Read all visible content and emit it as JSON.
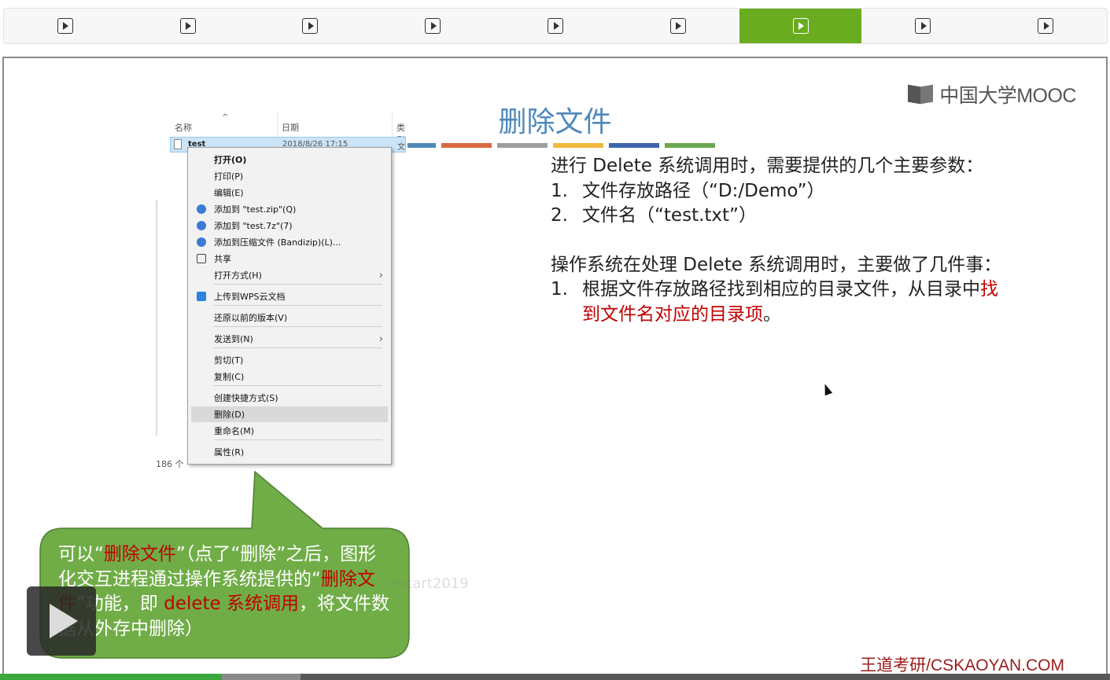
{
  "tabs": [
    {
      "icon": "play-icon",
      "active": false
    },
    {
      "icon": "play-icon",
      "active": false
    },
    {
      "icon": "play-icon",
      "active": false
    },
    {
      "icon": "play-icon",
      "active": false
    },
    {
      "icon": "play-icon",
      "active": false
    },
    {
      "icon": "play-icon",
      "active": false
    },
    {
      "icon": "play-icon",
      "active": true
    },
    {
      "icon": "play-icon",
      "active": false
    },
    {
      "icon": "play-icon",
      "active": false
    }
  ],
  "colors": {
    "active_tab": "#6aac1f",
    "title": "#4f88bb",
    "highlight": "#c00000",
    "callout": "#70ad47",
    "progress": "#3aa83a"
  },
  "logo": {
    "text": "中国大学MOOC"
  },
  "slide": {
    "title": "删除文件",
    "stripe_colors": [
      "#4f88bb",
      "#d9693f",
      "#9e9e9e",
      "#f0b840",
      "#3d64ae",
      "#6aa84f"
    ]
  },
  "explorer": {
    "col_name": "名称",
    "col_date": "日期",
    "col_type": "类型",
    "file_name": "test",
    "file_date": "2018/8/26 17:15",
    "file_type": "文",
    "status": "186 个"
  },
  "context_menu": [
    {
      "label": "打开(O)",
      "bold": true
    },
    {
      "label": "打印(P)"
    },
    {
      "label": "编辑(E)"
    },
    {
      "label": "添加到 \"test.zip\"(Q)",
      "icon": "bandizip-icon"
    },
    {
      "label": "添加到 \"test.7z\"(7)",
      "icon": "bandizip-icon"
    },
    {
      "label": "添加到压缩文件 (Bandizip)(L)...",
      "icon": "bandizip-icon"
    },
    {
      "label": "共享",
      "icon": "share-icon"
    },
    {
      "label": "打开方式(H)",
      "submenu": true
    },
    {
      "label": "上传到WPS云文档",
      "icon": "wps-cloud-icon"
    },
    {
      "label": "还原以前的版本(V)"
    },
    {
      "label": "发送到(N)",
      "submenu": true
    },
    {
      "label": "剪切(T)"
    },
    {
      "label": "复制(C)"
    },
    {
      "label": "创建快捷方式(S)"
    },
    {
      "label": "删除(D)",
      "highlighted": true
    },
    {
      "label": "重命名(M)"
    },
    {
      "label": "属性(R)"
    }
  ],
  "body": {
    "intro": "进行 Delete 系统调用时，需要提供的几个主要参数：",
    "params": [
      {
        "num": "1.",
        "text": "文件存放路径（“D:/Demo”）"
      },
      {
        "num": "2.",
        "text": "文件名（“test.txt”）"
      }
    ],
    "ops_intro": "操作系统在处理 Delete 系统调用时，主要做了几件事：",
    "ops": [
      {
        "num": "1.",
        "text_a": "根据文件存放路径找到相应的目录文件，从目录中",
        "text_red": "找到文件名对应的目录项",
        "text_b": "。"
      }
    ]
  },
  "callout": {
    "p1": "可以“",
    "r1": "删除文件",
    "p2": "”（点了“删除”之后，图形化交互进程通过操作系统提供的“",
    "r2": "删除文件",
    "p3": "”功能，即 ",
    "r3": "delete 系统调用",
    "p4": "，将文件数据从外存中删除）"
  },
  "watermark": "ehcart2019",
  "brand": "王道考研/CSKAOYAN.COM",
  "progress": {
    "played_fraction": 0.2
  }
}
